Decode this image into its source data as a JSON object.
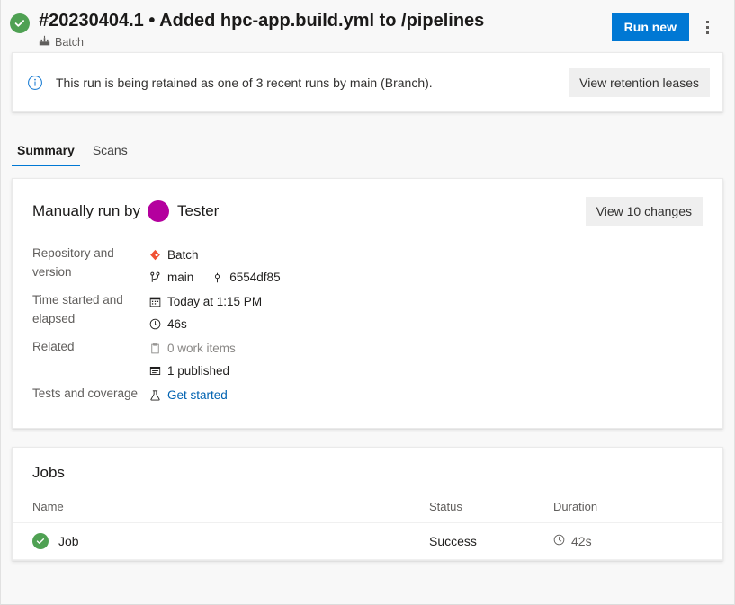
{
  "header": {
    "status_icon": "success-check-icon",
    "title": "#20230404.1 • Added hpc-app.build.yml to /pipelines",
    "subtitle": "Batch",
    "subtitle_icon": "pipeline-icon",
    "run_new_label": "Run new",
    "more_actions_icon": "kebab-menu-icon"
  },
  "banner": {
    "icon": "info-icon",
    "message": "This run is being retained as one of 3 recent runs by main (Branch).",
    "action_label": "View retention leases"
  },
  "tabs": [
    {
      "label": "Summary",
      "active": true
    },
    {
      "label": "Scans",
      "active": false
    }
  ],
  "summary": {
    "run_by_prefix": "Manually run by",
    "user": "Tester",
    "avatar_color": "#b4009e",
    "changes_button": "View 10 changes",
    "rows": [
      {
        "label": "Repository and version",
        "lines": [
          {
            "icon": "azure-repos-icon",
            "text": "Batch"
          },
          {
            "icon": "branch-icon",
            "text": "main",
            "icon2": "commit-icon",
            "text2": "6554df85"
          }
        ]
      },
      {
        "label": "Time started and elapsed",
        "lines": [
          {
            "icon": "calendar-icon",
            "text": "Today at 1:15 PM"
          },
          {
            "icon": "clock-icon",
            "text": "46s"
          }
        ]
      },
      {
        "label": "Related",
        "lines": [
          {
            "icon": "work-item-icon",
            "text": "0 work items",
            "muted": true
          },
          {
            "icon": "artifact-icon",
            "text": "1 published"
          }
        ]
      },
      {
        "label": "Tests and coverage",
        "lines": [
          {
            "icon": "test-flask-icon",
            "text": "Get started",
            "link": true
          }
        ]
      }
    ]
  },
  "jobs": {
    "title": "Jobs",
    "columns": [
      "Name",
      "Status",
      "Duration"
    ],
    "rows": [
      {
        "status_icon": "success-check-icon",
        "name": "Job",
        "status": "Success",
        "duration_icon": "clock-icon",
        "duration": "42s"
      }
    ]
  },
  "colors": {
    "accent": "#0078d4",
    "success": "#4fa153",
    "repo": "#f05133",
    "link": "#0062b1"
  }
}
